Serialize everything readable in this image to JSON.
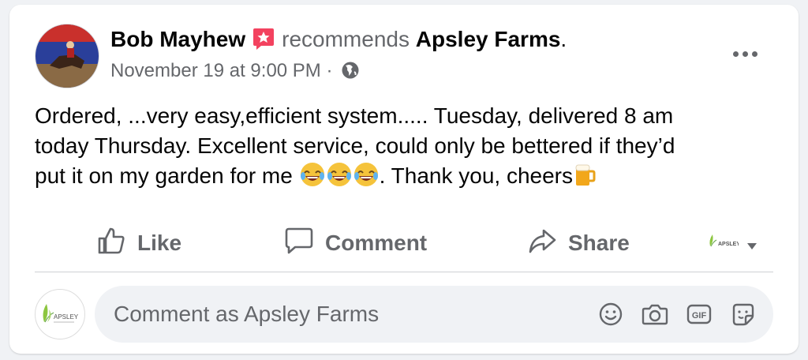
{
  "post": {
    "author": "Bob Mayhew",
    "recommends_text": "recommends",
    "page_name": "Apsley Farms",
    "page_name_suffix": ".",
    "timestamp": "November 19 at 9:00 PM",
    "meta_separator": " · ",
    "audience_icon": "globe-icon",
    "text_line1": "Ordered, ...very easy,efficient system..... Tuesday, delivered 8 am",
    "text_line2": "today Thursday. Excellent service, could only be bettered if they’d",
    "text_line3_a": "put it on my garden for me ",
    "emojis": [
      "😂",
      "😂",
      "😂"
    ],
    "text_line3_b": ". Thank you, cheers",
    "beer_emoji": "🍺"
  },
  "actions": {
    "like_label": "Like",
    "comment_label": "Comment",
    "share_label": "Share"
  },
  "comment": {
    "placeholder": "Comment as Apsley Farms",
    "icons": [
      "smiley-icon",
      "camera-icon",
      "gif-icon",
      "sticker-icon"
    ],
    "gif_text": "GIF"
  },
  "page_logo_text": "APSLEY",
  "colors": {
    "muted": "#65676b",
    "recommend_badge": "#f3425f",
    "logo_green": "#8cc63f"
  }
}
